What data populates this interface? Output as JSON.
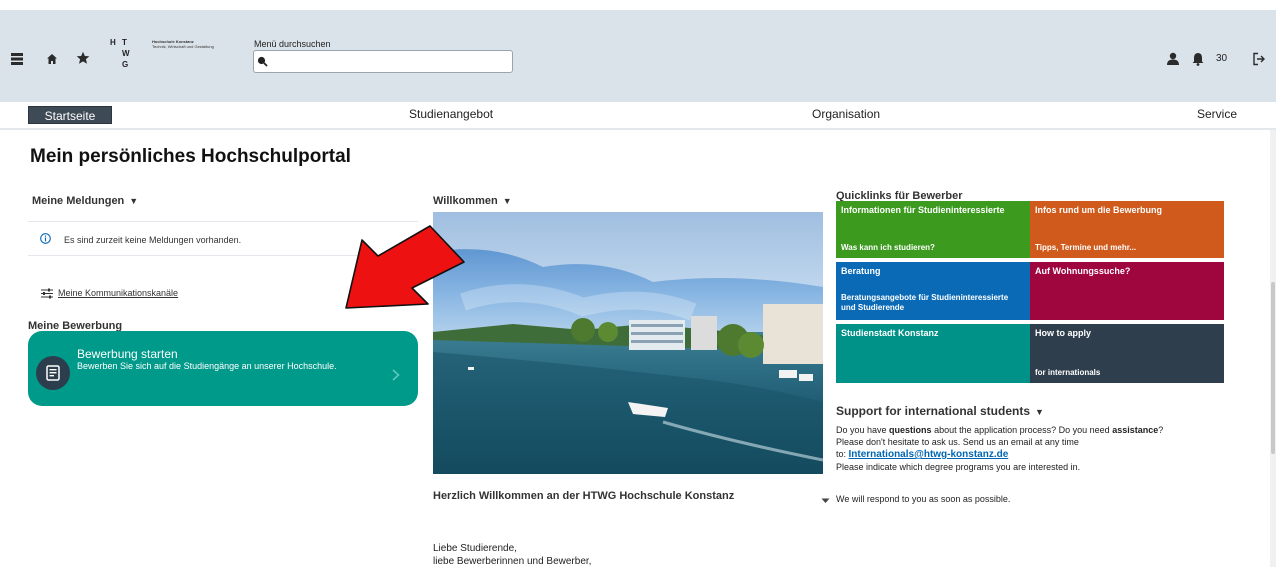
{
  "header": {
    "logo_letters": [
      "H",
      "T",
      "W",
      "G"
    ],
    "logo_name": "Hochschule Konstanz",
    "logo_subtitle": "Technik, Wirtschaft und Gestaltung",
    "search": {
      "label": "Menü durchsuchen",
      "placeholder": "",
      "value": ""
    },
    "notification_count": "30"
  },
  "nav": {
    "home": "Startseite",
    "items": [
      "Studienangebot",
      "Organisation",
      "Service"
    ]
  },
  "page_title": "Mein persönliches Hochschulportal",
  "meldungen": {
    "title": "Meine Meldungen",
    "empty_message": "Es sind zurzeit keine Meldungen vorhanden.",
    "channels_link": "Meine Kommunikationskanäle"
  },
  "bewerbung": {
    "title": "Meine Bewerbung",
    "card_title": "Bewerbung starten",
    "card_desc": "Bewerben Sie sich auf die Studiengänge an unserer Hochschule."
  },
  "welcome": {
    "title": "Willkommen",
    "text_title": "Herzlich Willkommen an der HTWG Hochschule Konstanz",
    "greeting_1": "Liebe Studierende,",
    "greeting_2": "liebe Bewerberinnen und Bewerber,"
  },
  "quicklinks": {
    "title": "Quicklinks für Bewerber",
    "tiles": [
      {
        "title": "Informationen für Studieninteressierte",
        "subtitle": "Was kann ich studieren?",
        "color": "#3c9a1f"
      },
      {
        "title": "Infos rund um die Bewerbung",
        "subtitle": "Tipps, Termine und mehr...",
        "color": "#cf5a1c"
      },
      {
        "title": "Beratung",
        "subtitle": "Beratungsangebote für Studieninteressierte und Studierende",
        "color": "#0a6ab6"
      },
      {
        "title": "Auf Wohnungssuche?",
        "subtitle": "",
        "color": "#a0063e"
      },
      {
        "title": "Studienstadt Konstanz",
        "subtitle": "",
        "color": "#009188"
      },
      {
        "title": "How to apply",
        "subtitle": "for internationals",
        "color": "#2f3e4c"
      }
    ]
  },
  "support": {
    "title": "Support for international students",
    "line1_a": "Do you have ",
    "line1_b": "questions",
    "line1_c": " about the application process? Do you need ",
    "line1_d": "assistance",
    "line1_e": "?",
    "line2": "Please don't hesitate to ask us. Send us an email at any time",
    "line3_prefix": "to: ",
    "email": "Internationals@htwg-konstanz.de",
    "line4": "Please indicate which degree programs you are interested in.",
    "line5": "We will respond to you as soon as possible."
  },
  "colors": {
    "header_bg": "#dbe3ea",
    "accent_teal": "#009a8a",
    "nav_active": "#3e4a56",
    "annotation_red": "#ee1111"
  }
}
